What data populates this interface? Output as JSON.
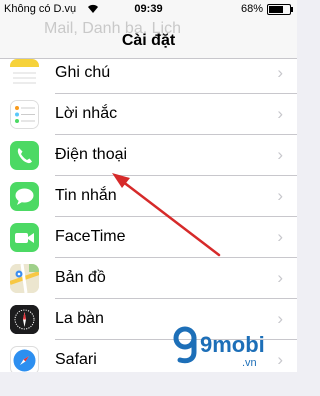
{
  "status": {
    "carrier": "Không có D.vụ",
    "time": "09:39",
    "battery": "68%",
    "battery_level": 0.68
  },
  "nav": {
    "title": "Cài đặt",
    "behind_title": "Mail, Danh bạ, Lịch"
  },
  "rows": [
    {
      "label": "Ghi chú",
      "icon": "notes-icon"
    },
    {
      "label": "Lời nhắc",
      "icon": "reminders-icon"
    },
    {
      "label": "Điện thoại",
      "icon": "phone-icon"
    },
    {
      "label": "Tin nhắn",
      "icon": "messages-icon"
    },
    {
      "label": "FaceTime",
      "icon": "facetime-icon"
    },
    {
      "label": "Bản đồ",
      "icon": "maps-icon"
    },
    {
      "label": "La bàn",
      "icon": "compass-icon"
    },
    {
      "label": "Safari",
      "icon": "safari-icon"
    }
  ],
  "watermark": {
    "brand": "9mobi",
    "tld": ".vn"
  },
  "colors": {
    "accent_arrow": "#d62a2a",
    "chevron": "#c7c7cc",
    "phone_green": "#4cd964",
    "watermark_blue": "#1d6fb8"
  }
}
